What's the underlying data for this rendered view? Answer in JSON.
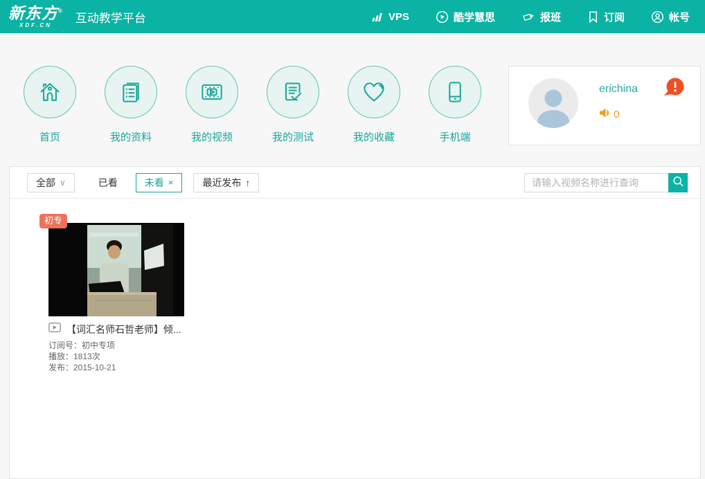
{
  "colors": {
    "teal": "#0ab3a3",
    "teal_text": "#17a798",
    "badge_coral": "#f0705a",
    "alert_red": "#f04e23",
    "orange": "#f59b1e"
  },
  "header": {
    "logo_title": "新东方",
    "logo_reg": "®",
    "logo_sub": "XDF.CN",
    "platform_name": "互动教学平台",
    "nav": [
      {
        "label": "VPS",
        "icon": "signal-bars-icon"
      },
      {
        "label": "酷学慧思",
        "icon": "play-circle-icon"
      },
      {
        "label": "报班",
        "icon": "tag-icon"
      },
      {
        "label": "订阅",
        "icon": "bookmark-icon"
      },
      {
        "label": "帐号",
        "icon": "user-circle-icon"
      }
    ]
  },
  "quick_nav": {
    "items": [
      {
        "label": "首页",
        "icon": "home-icon"
      },
      {
        "label": "我的资料",
        "icon": "documents-icon"
      },
      {
        "label": "我的视频",
        "icon": "film-icon"
      },
      {
        "label": "我的测试",
        "icon": "test-check-icon"
      },
      {
        "label": "我的收藏",
        "icon": "heart-icon"
      },
      {
        "label": "手机端",
        "icon": "phone-icon"
      }
    ]
  },
  "user_panel": {
    "username": "erichina",
    "message_count": "0"
  },
  "filter_bar": {
    "all_label": "全部",
    "all_caret": "∨",
    "watched_label": "已看",
    "unwatched_label": "未看",
    "unwatched_close": "×",
    "sort_label": "最近发布",
    "sort_arrow": "↑"
  },
  "search": {
    "placeholder": "请输入视频名称进行查询"
  },
  "video_list": [
    {
      "badge": "初专",
      "title": "【词汇名师石哲老师】倾...",
      "subscription": "订阅号：初中专项",
      "plays": "播放：1813次",
      "published": "发布：2015-10-21"
    }
  ]
}
